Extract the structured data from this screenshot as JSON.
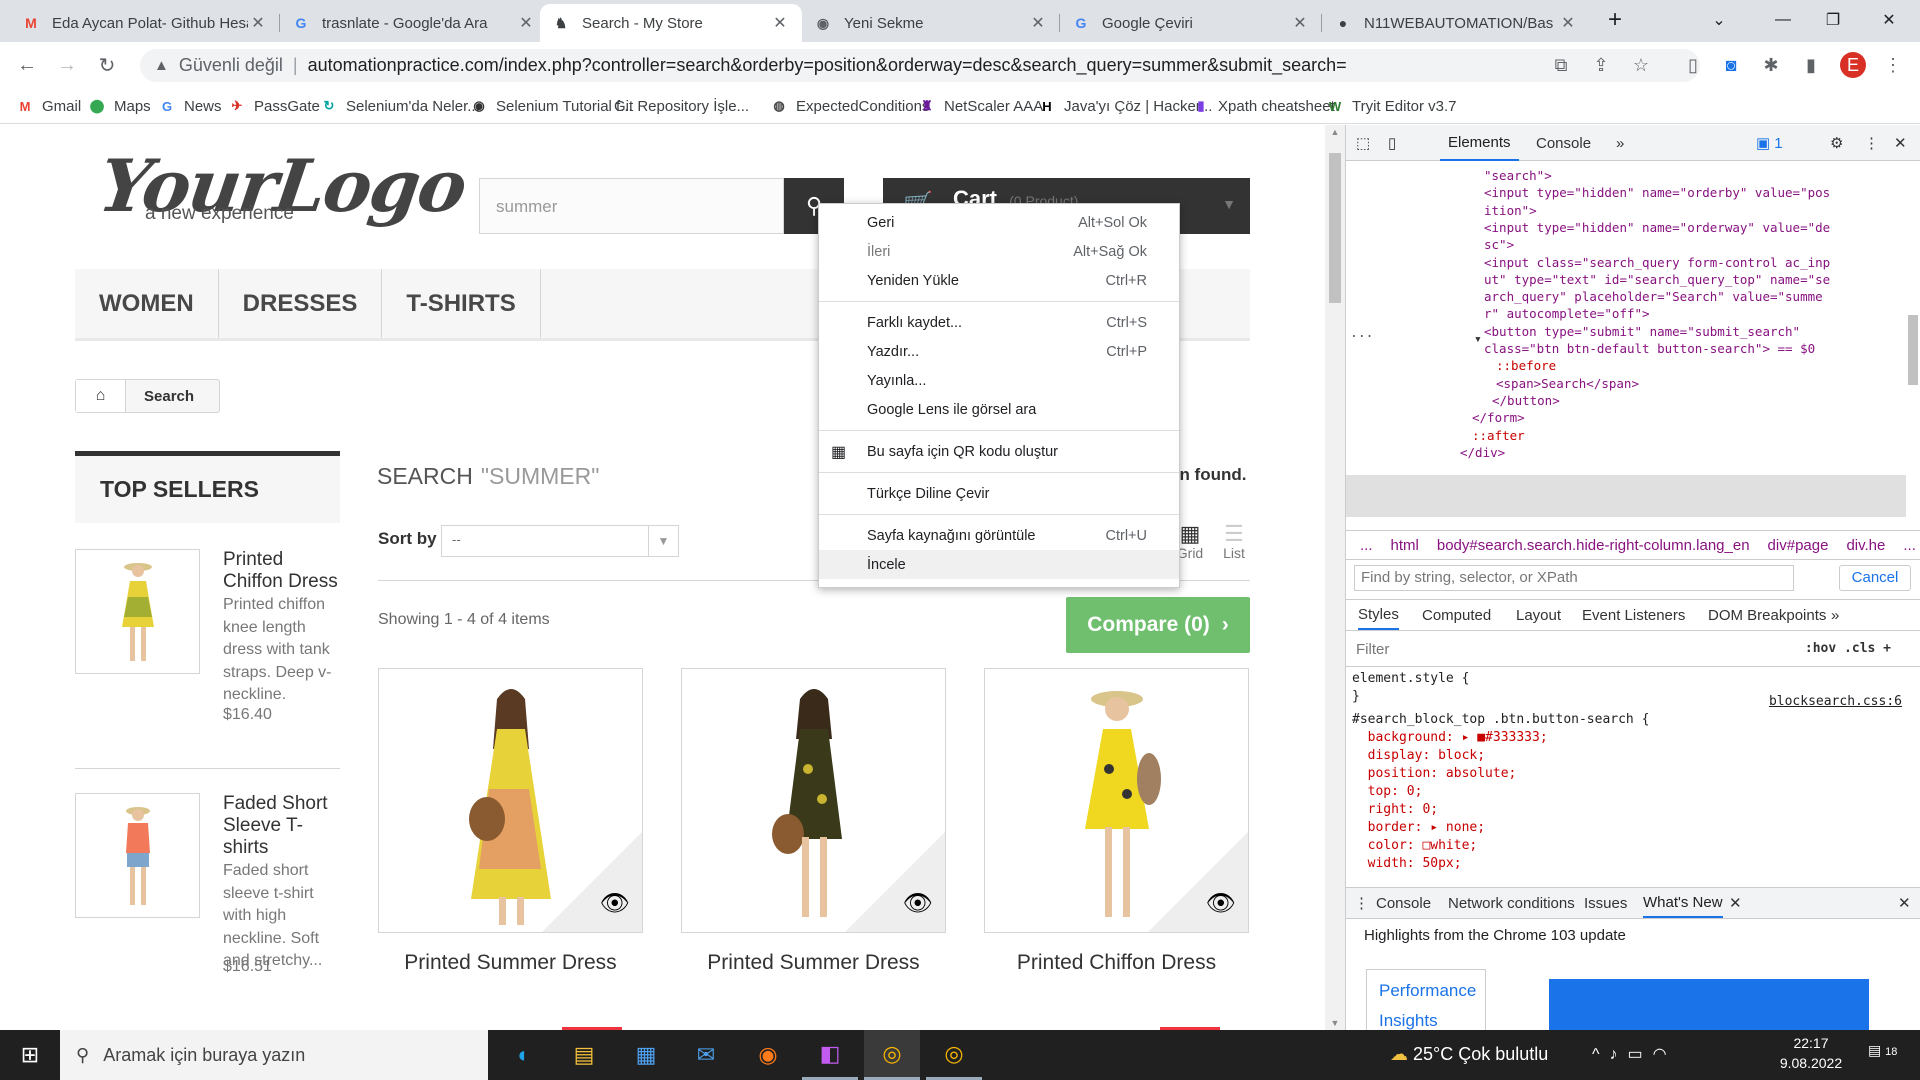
{
  "browser": {
    "tabs": [
      {
        "title": "Eda Aycan Polat- Github Hesa",
        "icon": "G",
        "icon_color": "#ea4335"
      },
      {
        "title": "trasnlate - Google'da Ara",
        "icon": "G",
        "icon_color": "#4285f4"
      },
      {
        "title": "Search - My Store",
        "icon": "♞",
        "icon_color": "#000000"
      },
      {
        "title": "Yeni Sekme",
        "icon": "◉",
        "icon_color": "#5f6368"
      },
      {
        "title": "Google Çeviri",
        "icon": "G",
        "icon_color": "#4285f4"
      },
      {
        "title": "N11WEBAUTOMATION/Bas",
        "icon": "●",
        "icon_color": "#202124"
      }
    ],
    "new_tab": "+",
    "security_label": "Güvenli değil",
    "url": "automationpractice.com/index.php?controller=search&orderby=position&orderway=desc&search_query=summer&submit_search=",
    "profile_initial": "E",
    "profile_color": "#d93025"
  },
  "bookmarks": [
    {
      "label": "Gmail",
      "icon": "M",
      "color": "#ea4335"
    },
    {
      "label": "Maps",
      "icon": "⬤",
      "color": "#34a853"
    },
    {
      "label": "News",
      "icon": "G",
      "color": "#4285f4"
    },
    {
      "label": "PassGate",
      "icon": "✈",
      "color": "#d93025"
    },
    {
      "label": "Selenium'da Neler...",
      "icon": "↻",
      "color": "#00a3a3"
    },
    {
      "label": "Selenium Tutorial f...",
      "icon": "◉",
      "color": "#333333"
    },
    {
      "label": "Git Repository İşle...",
      "icon": "",
      "color": "#ffffff"
    },
    {
      "label": "ExpectedConditions",
      "icon": "◍",
      "color": "#444444"
    },
    {
      "label": "NetScaler AAA",
      "icon": "♜",
      "color": "#6a1b9a"
    },
    {
      "label": "Java'yı Çöz | Hacker...",
      "icon": "H",
      "color": "#000000"
    },
    {
      "label": "Xpath cheatsheet",
      "icon": "▮",
      "color": "#7b3fe4"
    },
    {
      "label": "Tryit Editor v3.7",
      "icon": "W",
      "color": "#2e7d32"
    }
  ],
  "store": {
    "logo_main": "YourLogo",
    "logo_tagline": "a new experience",
    "search_value": "summer",
    "cart_label": "Cart",
    "cart_sub": "(0 Product)",
    "menu": [
      "WOMEN",
      "DRESSES",
      "T-SHIRTS"
    ],
    "breadcrumb": "Search",
    "top_sellers_title": "TOP SELLERS",
    "sellers": [
      {
        "name": "Printed Chiffon Dress",
        "desc": "Printed chiffon knee length dress with tank straps. Deep v-neckline.",
        "price": "$16.40"
      },
      {
        "name": "Faded Short Sleeve T-shirts",
        "desc": "Faded short sleeve t-shirt with high neckline. Soft and stretchy...",
        "price": "$16.51"
      }
    ],
    "search_heading": "SEARCH",
    "search_query_label": "\"SUMMER\"",
    "found_text": "en found.",
    "sort_label": "Sort by",
    "sort_value": "--",
    "view_grid": "Grid",
    "view_list": "List",
    "showing": "Showing 1 - 4 of 4 items",
    "compare": "Compare (0)",
    "products": [
      {
        "name": "Printed Summer Dress",
        "dress_color": "#e8d23a"
      },
      {
        "name": "Printed Summer Dress",
        "dress_color": "#3a3a1a"
      },
      {
        "name": "Printed Chiffon Dress",
        "dress_color": "#f0d820"
      }
    ]
  },
  "context_menu": {
    "groups": [
      [
        {
          "label": "Geri",
          "shortcut": "Alt+Sol Ok",
          "disabled": false
        },
        {
          "label": "İleri",
          "shortcut": "Alt+Sağ Ok",
          "disabled": true
        },
        {
          "label": "Yeniden Yükle",
          "shortcut": "Ctrl+R",
          "disabled": false
        }
      ],
      [
        {
          "label": "Farklı kaydet...",
          "shortcut": "Ctrl+S",
          "disabled": false
        },
        {
          "label": "Yazdır...",
          "shortcut": "Ctrl+P",
          "disabled": false
        },
        {
          "label": "Yayınla...",
          "shortcut": "",
          "disabled": false
        },
        {
          "label": "Google Lens ile görsel ara",
          "shortcut": "",
          "disabled": false
        }
      ],
      [
        {
          "label": "Bu sayfa için QR kodu oluştur",
          "shortcut": "",
          "disabled": false
        }
      ],
      [
        {
          "label": "Türkçe Diline Çevir",
          "shortcut": "",
          "disabled": false
        }
      ],
      [
        {
          "label": "Sayfa kaynağını görüntüle",
          "shortcut": "Ctrl+U",
          "disabled": false
        },
        {
          "label": "İncele",
          "shortcut": "",
          "disabled": false,
          "highlighted": true
        }
      ]
    ]
  },
  "devtools": {
    "tabs": [
      "Elements",
      "Console"
    ],
    "issues_badge": "1",
    "code_lines": [
      "\"search\">",
      "<input type=\"hidden\" name=\"orderby\" value=\"pos",
      "ition\">",
      "<input type=\"hidden\" name=\"orderway\" value=\"de",
      "sc\">",
      "<input class=\"search_query form-control ac_inp",
      "ut\" type=\"text\" id=\"search_query_top\" name=\"se",
      "arch_query\" placeholder=\"Search\" value=\"summe",
      "r\" autocomplete=\"off\">",
      "<button type=\"submit\" name=\"submit_search\"",
      "class=\"btn btn-default button-search\"> == $0",
      "::before",
      "<span>Search</span>",
      "</button>",
      "</form>",
      "::after",
      "</div>"
    ],
    "crumbs": [
      "...",
      "html",
      "body#search.search.hide-right-column.lang_en",
      "div#page",
      "div.he",
      "..."
    ],
    "find_placeholder": "Find by string, selector, or XPath",
    "cancel": "Cancel",
    "subtabs": [
      "Styles",
      "Computed",
      "Layout",
      "Event Listeners",
      "DOM Breakpoints"
    ],
    "filter_placeholder": "Filter",
    "filter_tools": ":hov  .cls  +",
    "style_lines": [
      "element.style {",
      "}",
      "#search_block_top .btn.button-search {",
      "  background: ▸ ■#333333;",
      "  display: block;",
      "  position: absolute;",
      "  top: 0;",
      "  right: 0;",
      "  border: ▸ none;",
      "  color: □white;",
      "  width: 50px;"
    ],
    "style_source": "blocksearch.css:6",
    "drawer_tabs": [
      "Console",
      "Network conditions",
      "Issues",
      "What's New"
    ],
    "highlights": "Highlights from the Chrome 103 update",
    "perf_label": "Performance Insights"
  },
  "taskbar": {
    "search_placeholder": "Aramak için buraya yazın",
    "weather": "25°C  Çok bulutlu",
    "time": "22:17",
    "date": "9.08.2022",
    "notif_count": "18"
  }
}
